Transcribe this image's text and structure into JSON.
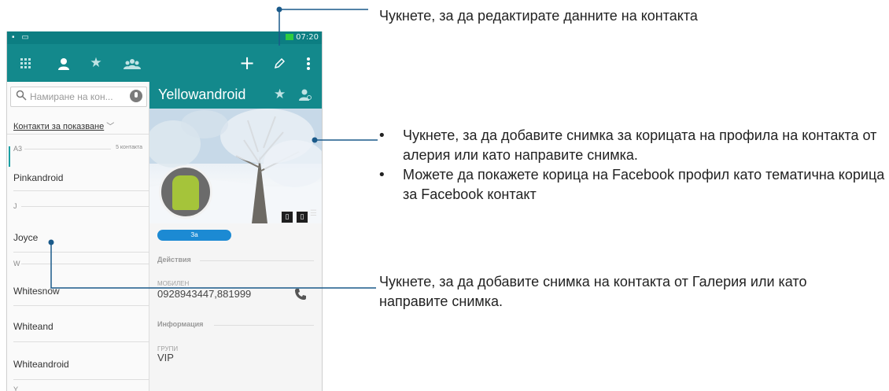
{
  "statusbar": {
    "left_icons": "▪ ▭",
    "right_text": "◢ .ıl ⊡ ° 07:20",
    "time": "07:20"
  },
  "toolbar": {
    "icons": [
      "apps-grid-icon",
      "person-icon",
      "star-icon",
      "groups-icon",
      "add-icon",
      "edit-pencil-icon",
      "overflow-menu-icon"
    ]
  },
  "search": {
    "placeholder": "Намиране на кон..."
  },
  "contacts": {
    "filter_label": "Контакти за показване",
    "section_a": {
      "letter": "A3",
      "count": "5 контакта"
    },
    "rows": [
      "Pinkandroid",
      "Joyce",
      "Whitesnow",
      "Whiteand",
      "Whiteandroid"
    ],
    "section_j": "J",
    "section_w": "W",
    "section_y": "Y"
  },
  "detail": {
    "name": "Yellowandroid",
    "about_label": "За",
    "actions_title": "Действия",
    "phone_label": "МОБИЛЕН",
    "phone_value": "0928943447,881999",
    "info_title": "Информация",
    "groups_label": "ГРУПИ",
    "groups_value": "VIP"
  },
  "callouts": {
    "edit": "Чукнете, за да редактирате данните на контакта",
    "cover_bullets": [
      "Чукнете, за да добавите снимка за корицата на профила на контакта от алерия или като направите снимка.",
      "Можете да покажете корица на Facebook профил като тематична корица за Facebook контакт"
    ],
    "photo": "Чукнете, за да добавите снимка на контакта от Галерия или като направите снимка."
  },
  "colors": {
    "toolbar": "#13898c",
    "statusbar": "#0c7e82",
    "callout_line": "#1a5a8a",
    "about_pill": "#1c8ad3"
  }
}
